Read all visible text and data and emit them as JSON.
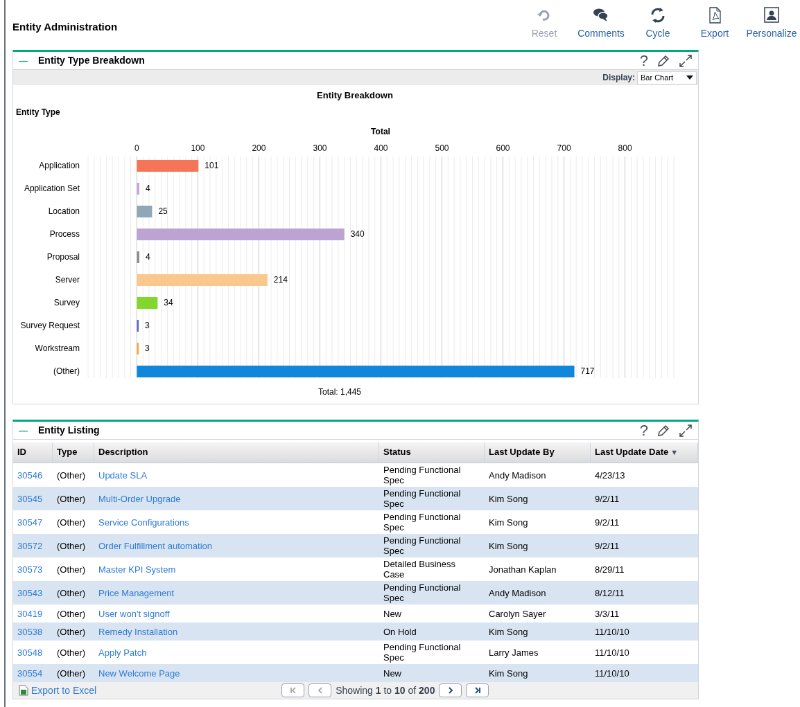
{
  "page": {
    "title": "Entity Administration"
  },
  "toolbar": [
    {
      "label": "Reset",
      "kind": "reset",
      "disabled": true
    },
    {
      "label": "Comments",
      "kind": "comments",
      "disabled": false
    },
    {
      "label": "Cycle",
      "kind": "cycle",
      "disabled": false
    },
    {
      "label": "Export",
      "kind": "export",
      "disabled": false
    },
    {
      "label": "Personalize",
      "kind": "personalize",
      "disabled": false
    }
  ],
  "breakdown_panel": {
    "title": "Entity Type Breakdown",
    "collapse_glyph": "—",
    "help_glyph": "?",
    "display_label": "Display:",
    "display_value": "Bar Chart",
    "total_text": "Total: 1,445",
    "chart_data": {
      "type": "bar",
      "orientation": "horizontal",
      "title": "Entity Breakdown",
      "ylabel": "Entity Type",
      "categories": [
        "Application",
        "Application Set",
        "Location",
        "Process",
        "Proposal",
        "Server",
        "Survey",
        "Survey Request",
        "Workstream",
        "(Other)"
      ],
      "series": [
        {
          "name": "Total",
          "values": [
            101,
            4,
            25,
            340,
            4,
            214,
            34,
            3,
            3,
            717
          ]
        }
      ],
      "grid": true,
      "colors": [
        "#f47558",
        "#c3a4dc",
        "#90a7b7",
        "#bca3d1",
        "#8c8c8c",
        "#fac88c",
        "#82d62c",
        "#5d66bf",
        "#f8a43a",
        "#1187dc"
      ],
      "xlim": [
        -80,
        880
      ],
      "xticks": [
        0,
        100,
        200,
        300,
        400,
        500,
        600,
        700,
        800
      ],
      "data_labels": true
    }
  },
  "listing_panel": {
    "title": "Entity Listing",
    "collapse_glyph": "—",
    "help_glyph": "?",
    "columns": [
      {
        "label": "ID",
        "sorted": false
      },
      {
        "label": "Type",
        "sorted": false
      },
      {
        "label": "Description",
        "sorted": false
      },
      {
        "label": "Status",
        "sorted": false
      },
      {
        "label": "Last Update By",
        "sorted": false
      },
      {
        "label": "Last Update Date",
        "sorted": true
      }
    ],
    "sort_glyph": "▼",
    "rows": [
      [
        "30546",
        "(Other)",
        "Update SLA",
        "Pending Functional Spec",
        "Andy Madison",
        "4/23/13"
      ],
      [
        "30545",
        "(Other)",
        "Multi-Order Upgrade",
        "Pending Functional Spec",
        "Kim Song",
        "9/2/11"
      ],
      [
        "30547",
        "(Other)",
        "Service Configurations",
        "Pending Functional Spec",
        "Kim Song",
        "9/2/11"
      ],
      [
        "30572",
        "(Other)",
        "Order Fulfillment automation",
        "Pending Functional Spec",
        "Kim Song",
        "9/2/11"
      ],
      [
        "30573",
        "(Other)",
        "Master KPI System",
        "Detailed Business Case",
        "Jonathan Kaplan",
        "8/29/11"
      ],
      [
        "30543",
        "(Other)",
        "Price Management",
        "Pending Functional Spec",
        "Andy Madison",
        "8/12/11"
      ],
      [
        "30419",
        "(Other)",
        "User won't signoff",
        "New",
        "Carolyn Sayer",
        "3/3/11"
      ],
      [
        "30538",
        "(Other)",
        "Remedy Installation",
        "On Hold",
        "Kim Song",
        "11/10/10"
      ],
      [
        "30548",
        "(Other)",
        "Apply Patch",
        "Pending Functional Spec",
        "Larry James",
        "11/10/10"
      ],
      [
        "30554",
        "(Other)",
        "New Welcome Page",
        "New",
        "Kim Song",
        "11/10/10"
      ]
    ],
    "export_link": "Export to Excel",
    "paging_text": "Showing **1** to **10** of **200**"
  }
}
